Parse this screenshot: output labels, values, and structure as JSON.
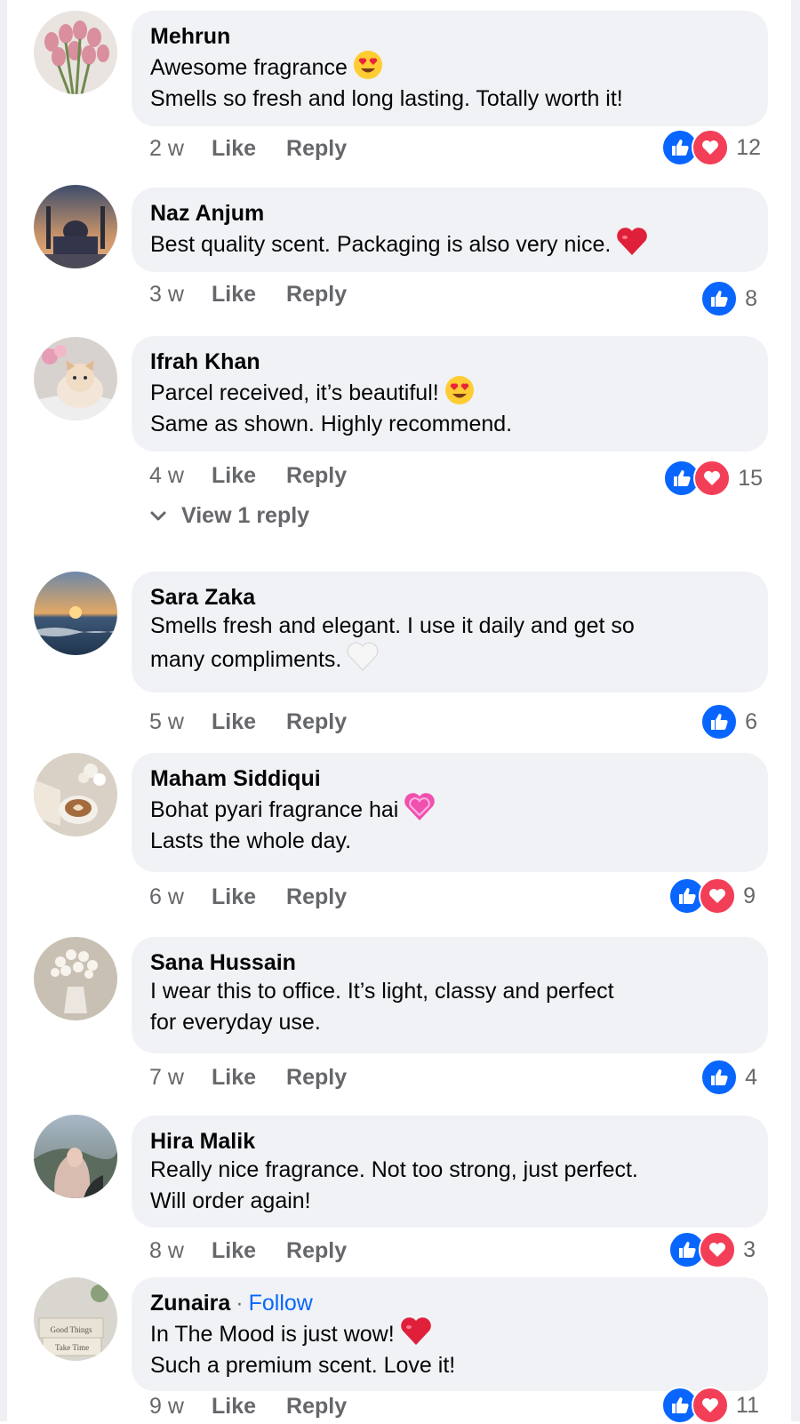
{
  "comments": [
    {
      "author": "Mehrun",
      "lines": [
        "Awesome fragrance",
        "Smells so fresh and long lasting. Totally worth it!"
      ],
      "emoji_line": 0,
      "emoji": "heart-eyes-emoji",
      "time": "2 w",
      "like": "Like",
      "reply": "Reply",
      "reactions": [
        "like",
        "love"
      ],
      "count": "12",
      "avatar": "tulips-avatar"
    },
    {
      "author": "Naz Anjum",
      "lines": [
        "Best quality scent. Packaging is also very nice."
      ],
      "emoji_line": 0,
      "emoji": "red-heart-emoji",
      "time": "3 w",
      "like": "Like",
      "reply": "Reply",
      "reactions": [
        "like"
      ],
      "count": "8",
      "avatar": "mosque-avatar"
    },
    {
      "author": "Ifrah Khan",
      "lines": [
        "Parcel received, it’s beautiful!",
        "Same as shown. Highly recommend."
      ],
      "emoji_line": 0,
      "emoji": "heart-eyes-emoji",
      "time": "4 w",
      "like": "Like",
      "reply": "Reply",
      "reactions": [
        "like",
        "love"
      ],
      "count": "15",
      "avatar": "cat-avatar",
      "view_replies": "View 1 reply"
    },
    {
      "author": "Sara Zaka",
      "lines": [
        "Smells fresh and elegant. I use it daily and get so",
        "many compliments."
      ],
      "emoji_line": 1,
      "emoji": "white-heart-emoji",
      "time": "5 w",
      "like": "Like",
      "reply": "Reply",
      "reactions": [
        "like"
      ],
      "count": "6",
      "avatar": "sunset-avatar"
    },
    {
      "author": "Maham Siddiqui",
      "lines": [
        "Bohat pyari fragrance hai",
        "Lasts the whole day."
      ],
      "emoji_line": 0,
      "emoji": "pink-heart-emoji",
      "time": "6 w",
      "like": "Like",
      "reply": "Reply",
      "reactions": [
        "like",
        "love"
      ],
      "count": "9",
      "avatar": "coffee-avatar"
    },
    {
      "author": "Sana Hussain",
      "lines": [
        "I wear this to office. It’s light, classy and perfect",
        "for everyday use."
      ],
      "emoji_line": -1,
      "emoji": "",
      "time": "7 w",
      "like": "Like",
      "reply": "Reply",
      "reactions": [
        "like"
      ],
      "count": "4",
      "avatar": "flowers-vase-avatar"
    },
    {
      "author": "Hira Malik",
      "lines": [
        "Really nice fragrance. Not too strong, just perfect.",
        "Will order again!"
      ],
      "emoji_line": -1,
      "emoji": "",
      "time": "8 w",
      "like": "Like",
      "reply": "Reply",
      "reactions": [
        "like",
        "love"
      ],
      "count": "3",
      "avatar": "hijab-woman-avatar"
    },
    {
      "author": "Zunaira",
      "follow": "Follow",
      "dot": "·",
      "lines": [
        "In The Mood is just wow!",
        "Such a premium scent. Love it!"
      ],
      "emoji_line": 0,
      "emoji": "red-heart-emoji",
      "time": "9 w",
      "like": "Like",
      "reply": "Reply",
      "reactions": [
        "like",
        "love"
      ],
      "count": "11",
      "avatar": "books-avatar",
      "book_titles": [
        "Good Things",
        "Take Time"
      ]
    }
  ],
  "colors": {
    "bubble": "#f0f2f5",
    "like_blue": "#0866ff",
    "love_red": "#f33e58",
    "secondary_text": "#65676b",
    "link_blue": "#0866ff"
  }
}
